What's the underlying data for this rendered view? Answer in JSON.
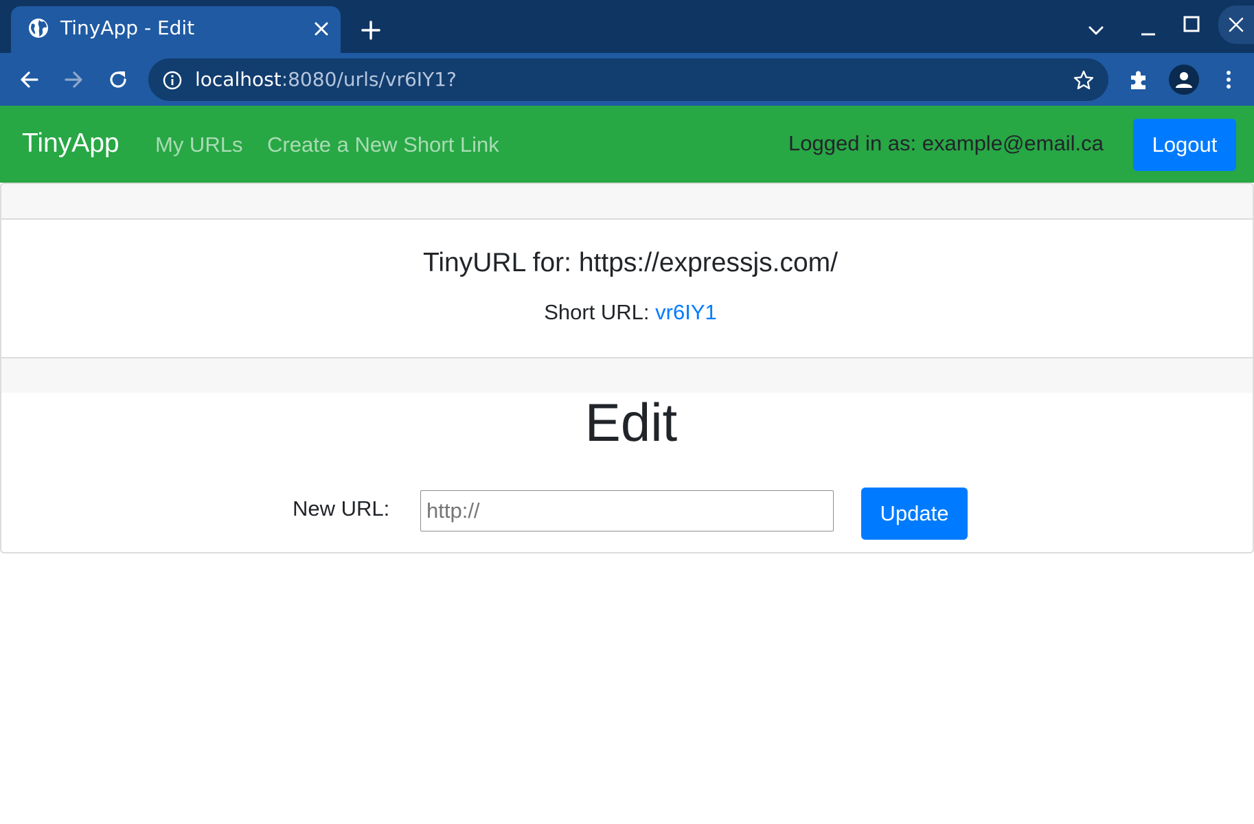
{
  "browser": {
    "tab_title": "TinyApp - Edit",
    "url_host": "localhost",
    "url_rest": ":8080/urls/vr6IY1?",
    "icons": [
      "globe-icon",
      "close-icon",
      "plus-icon",
      "chevron-down-icon",
      "minimize-icon",
      "maximize-icon",
      "close-icon",
      "back-arrow-icon",
      "forward-arrow-icon",
      "reload-icon",
      "info-icon",
      "star-icon",
      "puzzle-icon",
      "profile-icon",
      "more-vertical-icon"
    ]
  },
  "navbar": {
    "brand": "TinyApp",
    "links": [
      "My URLs",
      "Create a New Short Link"
    ],
    "logged_in_text": "Logged in as: example@email.ca",
    "logout_label": "Logout",
    "background_color": "#28a745"
  },
  "card": {
    "title": "TinyURL for: https://expressjs.com/",
    "short_url_label": "Short URL:",
    "short_url_value": "vr6IY1"
  },
  "edit_form": {
    "heading": "Edit",
    "label": "New URL:",
    "input_placeholder": "http://",
    "input_value": "",
    "submit_label": "Update",
    "button_color": "#007bff"
  }
}
